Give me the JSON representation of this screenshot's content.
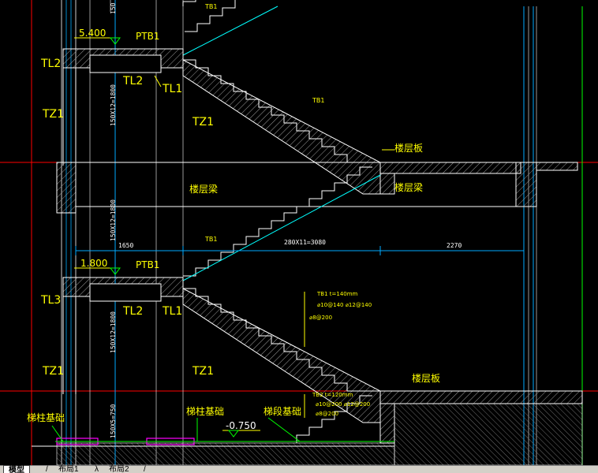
{
  "drawing": {
    "labels": {
      "tb1_top": "TB1",
      "elev_top": "5.400",
      "ptb1_top": "PTB1",
      "tl2_left": "TL2",
      "tl2_mid": "TL2",
      "tl1_top": "TL1",
      "tz1_left_top": "TZ1",
      "tz1_right_top": "TZ1",
      "tb1_mid": "TB1",
      "floor_slab_1": "楼层板",
      "floor_beam_left": "楼层梁",
      "floor_beam_right": "楼层梁",
      "tb1_lower_small": "TB1",
      "elev_mid": "1.800",
      "ptb1_mid": "PTB1",
      "tl3_left": "TL3",
      "tl2_lower": "TL2",
      "tl1_lower": "TL1",
      "tz1_left_bottom": "TZ1",
      "tz1_right_bottom": "TZ1",
      "tb1_note_1": "TB1 t=140mm",
      "tb1_note_2": "⌀10@140 ⌀12@140",
      "tb1_note_3": "⌀8@200",
      "floor_slab_2": "楼层板",
      "tb2_note_1": "TB2 t=120mm",
      "tb2_note_2": "⌀10@200 ⌀12@200",
      "tb2_note_3": "⌀8@200",
      "col_foundation_left": "梯柱基础",
      "col_foundation_mid": "梯柱基础",
      "elev_bottom": "-0.750",
      "stair_foundation": "梯段基础"
    },
    "dims": {
      "h_left": "1650",
      "h_mid": "280X11=3080",
      "h_right": "2270",
      "v_top": "150X12=1800",
      "v_mid_upper": "150X12=1800",
      "v_mid_lower": "150X12=1800",
      "v_bottom": "150X5=750",
      "v_cut_top": "150"
    }
  },
  "tabs": [
    "模型",
    "布局1",
    "布局2"
  ],
  "active_tab": 0,
  "colors": {
    "background": "#000000",
    "text": "#ffff00",
    "structure": "#ffffff",
    "axis_red": "#ff0000",
    "axis_cyan": "#00ffff",
    "dim_blue": "#00aaff",
    "green": "#00ff00",
    "magenta": "#ff00ff",
    "hatch": "#808080"
  }
}
